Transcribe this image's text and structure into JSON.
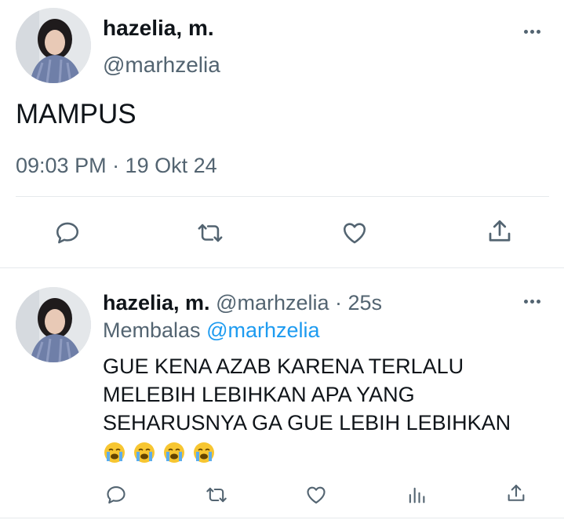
{
  "main_tweet": {
    "display_name": "hazelia, m.",
    "handle": "@marhzelia",
    "text": "MAMPUS",
    "timestamp": "09:03 PM · 19 Okt 24"
  },
  "reply": {
    "display_name": "hazelia, m.",
    "handle_time": "@marhzelia · 25s",
    "replying_prefix": "Membalas",
    "replying_to": "@marhzelia",
    "text_lines": [
      "GUE KENA AZAB KARENA TERLALU",
      "MELEBIH LEBIHKAN APA YANG",
      "SEHARUSNYA GA GUE LEBIH LEBIHKAN"
    ],
    "emoji_count_shown": 4
  },
  "colors": {
    "text": "#0f1419",
    "secondary": "#536471",
    "link": "#1d9bf0",
    "divider": "#e6e9ec"
  },
  "icons": [
    "more-icon",
    "reply-icon",
    "retweet-icon",
    "like-icon",
    "share-icon",
    "analytics-icon",
    "crying-emoji-icon"
  ]
}
